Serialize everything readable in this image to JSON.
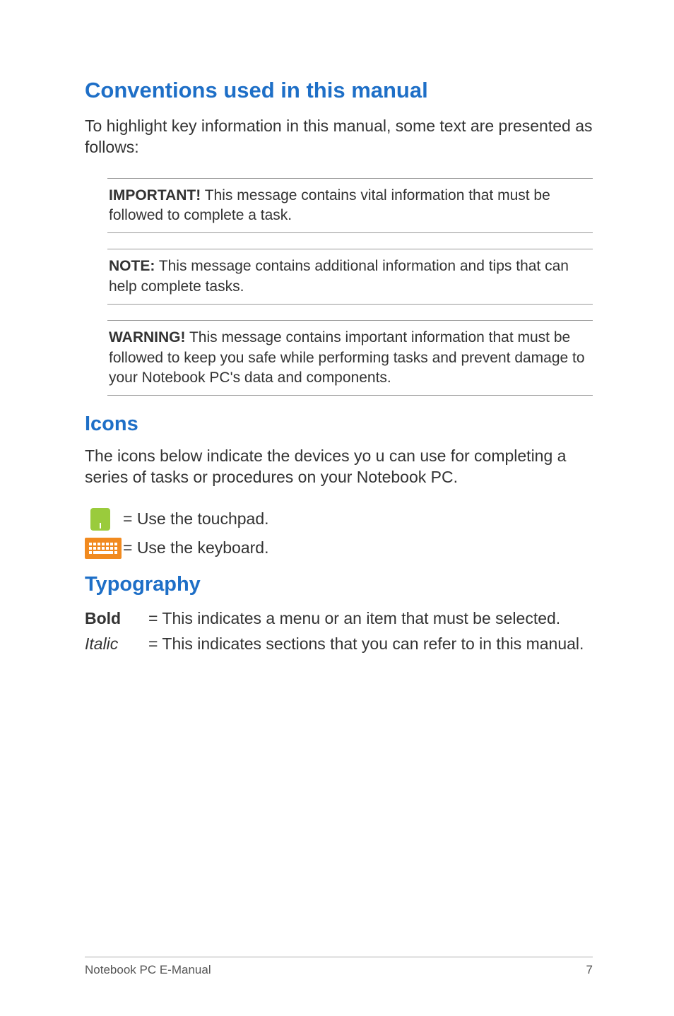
{
  "headings": {
    "conventions": "Conventions used in this manual",
    "icons": "Icons",
    "typography": "Typography"
  },
  "intro": "To highlight key information in this manual, some text are presented as follows:",
  "callouts": {
    "important": {
      "label": "IMPORTANT!",
      "text": " This message contains vital information that must be followed to complete a task."
    },
    "note": {
      "label": "NOTE:",
      "text": " This message contains additional information and tips that can help complete tasks."
    },
    "warning": {
      "label": "WARNING!",
      "text": " This message contains important information that must be followed to keep you safe while performing tasks and prevent damage to your Notebook PC's data and components."
    }
  },
  "icons_intro": "The icons below indicate the devices yo u can use for completing a series of tasks or procedures on your Notebook PC.",
  "icon_rows": {
    "touchpad": "= Use the touchpad.",
    "keyboard": "= Use the keyboard."
  },
  "typography": {
    "bold": {
      "label": "Bold",
      "text": "= This indicates a menu or an item that must be selected."
    },
    "italic": {
      "label": "Italic",
      "text": "= This indicates sections that you can refer to in this manual."
    }
  },
  "footer": {
    "left": "Notebook PC E-Manual",
    "right": "7"
  }
}
